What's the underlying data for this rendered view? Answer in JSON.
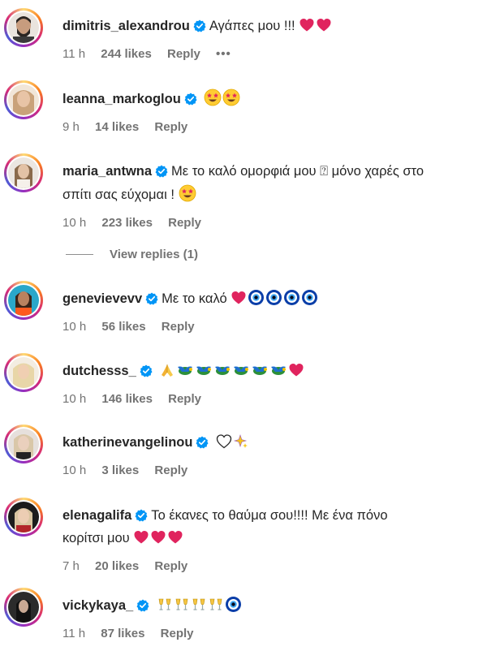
{
  "comments": [
    {
      "username": "dimitris_alexandrou",
      "verified": true,
      "text": "Αγάπες μου !!!",
      "emojis": [
        "red-heart",
        "red-heart"
      ],
      "time": "11 h",
      "likes": "244 likes",
      "reply": "Reply",
      "more": "•••",
      "avatar_bg": "#3a3a3a"
    },
    {
      "username": "leanna_markoglou",
      "verified": true,
      "text": "",
      "emojis": [
        "star-struck",
        "star-struck"
      ],
      "time": "9 h",
      "likes": "14 likes",
      "reply": "Reply",
      "avatar_bg": "#c9a27a"
    },
    {
      "username": "maria_antwna",
      "verified": true,
      "text_line1": "Με το καλό ομορφιά μου ⍰ μόνο χαρές στο",
      "text_line2": "σπίτι σας εύχομαι !",
      "emojis": [
        "star-struck"
      ],
      "time": "10 h",
      "likes": "223 likes",
      "reply": "Reply",
      "avatar_bg": "#d8c7b6"
    },
    {
      "username": "genevievevv",
      "verified": true,
      "text": "Με το καλό",
      "emojis": [
        "red-heart",
        "nazar-amulet",
        "nazar-amulet",
        "nazar-amulet",
        "nazar-amulet"
      ],
      "time": "10 h",
      "likes": "56 likes",
      "reply": "Reply",
      "avatar_bg": "#2aa7c9"
    },
    {
      "username": "dutchesss_",
      "verified": true,
      "text": "",
      "emojis": [
        "folded-hands",
        "dove",
        "dove",
        "dove",
        "dove",
        "dove",
        "dove",
        "red-heart"
      ],
      "time": "10 h",
      "likes": "146 likes",
      "reply": "Reply",
      "avatar_bg": "#e8d6a8"
    },
    {
      "username": "katherinevangelinou",
      "verified": true,
      "text": "",
      "emojis": [
        "white-heart",
        "sparkles"
      ],
      "time": "10 h",
      "likes": "3 likes",
      "reply": "Reply",
      "avatar_bg": "#cfc4bd"
    },
    {
      "username": "elenagalifa",
      "verified": true,
      "text_line1": "Το έκανες το θαύμα σου!!!! Με ένα πόνο",
      "text_line2": "κορίτσι μου",
      "emojis": [
        "red-heart",
        "red-heart",
        "red-heart"
      ],
      "time": "7 h",
      "likes": "20 likes",
      "reply": "Reply",
      "avatar_bg": "#7a4a3a"
    },
    {
      "username": "vickykaya_",
      "verified": true,
      "text": "",
      "emojis": [
        "clinking-glasses",
        "clinking-glasses",
        "clinking-glasses",
        "clinking-glasses",
        "nazar-amulet"
      ],
      "time": "11 h",
      "likes": "87 likes",
      "reply": "Reply",
      "avatar_bg": "#2b2b2b"
    }
  ],
  "view_replies": "View replies (1)",
  "colors": {
    "verified_blue": "#0095f6",
    "meta_gray": "#737373",
    "heart_red": "#e0245e",
    "ring_gradient": [
      "#feda75",
      "#fa7e1e",
      "#d62976",
      "#962fbf",
      "#4f5bd5"
    ]
  }
}
